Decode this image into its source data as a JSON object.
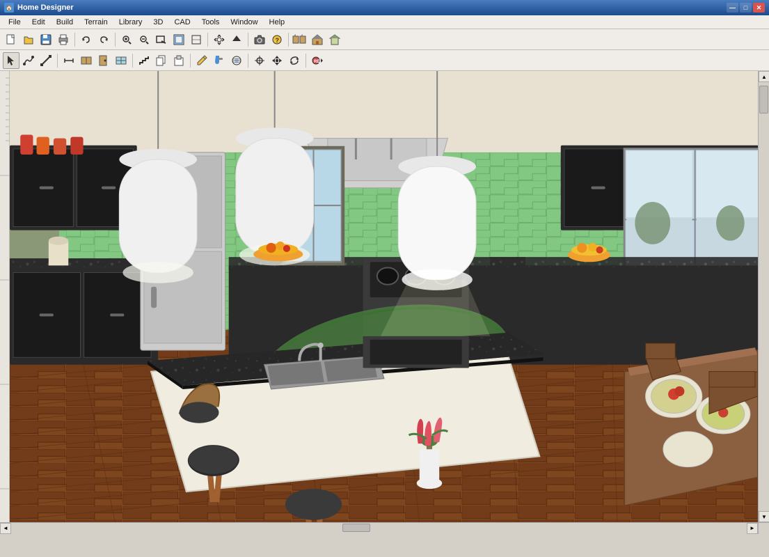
{
  "window": {
    "title": "Home Designer",
    "icon": "🏠"
  },
  "titleBar": {
    "title": "Home Designer",
    "controls": {
      "minimize": "—",
      "maximize": "□",
      "close": "✕"
    }
  },
  "menuBar": {
    "items": [
      "File",
      "Edit",
      "Build",
      "Terrain",
      "Library",
      "3D",
      "CAD",
      "Tools",
      "Window",
      "Help"
    ]
  },
  "toolbar1": {
    "buttons": [
      {
        "name": "new",
        "icon": "📄"
      },
      {
        "name": "open",
        "icon": "📂"
      },
      {
        "name": "save",
        "icon": "💾"
      },
      {
        "name": "print",
        "icon": "🖨"
      },
      {
        "name": "undo",
        "icon": "↩"
      },
      {
        "name": "redo",
        "icon": "↪"
      },
      {
        "name": "zoom-in-btn",
        "icon": "🔍"
      },
      {
        "name": "zoom-out-btn",
        "icon": "🔎"
      },
      {
        "name": "zoom-window",
        "icon": "⊕"
      },
      {
        "name": "zoom-fit",
        "icon": "⊞"
      },
      {
        "name": "zoom-sheet",
        "icon": "⊡"
      },
      {
        "name": "pan",
        "icon": "✋"
      },
      {
        "name": "arrow-up-icon",
        "icon": "↑"
      },
      {
        "name": "camera",
        "icon": "📷"
      },
      {
        "name": "help-btn",
        "icon": "?"
      },
      {
        "name": "sep1",
        "icon": ""
      },
      {
        "name": "wall-btn",
        "icon": "🏠"
      },
      {
        "name": "roof-btn",
        "icon": "🏡"
      },
      {
        "name": "terrain-btn",
        "icon": "⛰"
      }
    ]
  },
  "toolbar2": {
    "buttons": [
      {
        "name": "select",
        "icon": "↖"
      },
      {
        "name": "polyline",
        "icon": "⌒"
      },
      {
        "name": "line",
        "icon": "—"
      },
      {
        "name": "dimension",
        "icon": "↔"
      },
      {
        "name": "cabinet",
        "icon": "▦"
      },
      {
        "name": "door",
        "icon": "🚪"
      },
      {
        "name": "window-tool",
        "icon": "⊟"
      },
      {
        "name": "stairs",
        "icon": "⊿"
      },
      {
        "name": "copy",
        "icon": "⧉"
      },
      {
        "name": "paste",
        "icon": "📋"
      },
      {
        "name": "pencil",
        "icon": "✏"
      },
      {
        "name": "paint",
        "icon": "🖌"
      },
      {
        "name": "texture",
        "icon": "◈"
      },
      {
        "name": "snap",
        "icon": "⊕"
      },
      {
        "name": "move",
        "icon": "✥"
      },
      {
        "name": "rotate",
        "icon": "↻"
      },
      {
        "name": "rec",
        "icon": "⏺"
      }
    ]
  },
  "scene": {
    "description": "3D Kitchen interior view"
  },
  "statusBar": {
    "text": ""
  }
}
